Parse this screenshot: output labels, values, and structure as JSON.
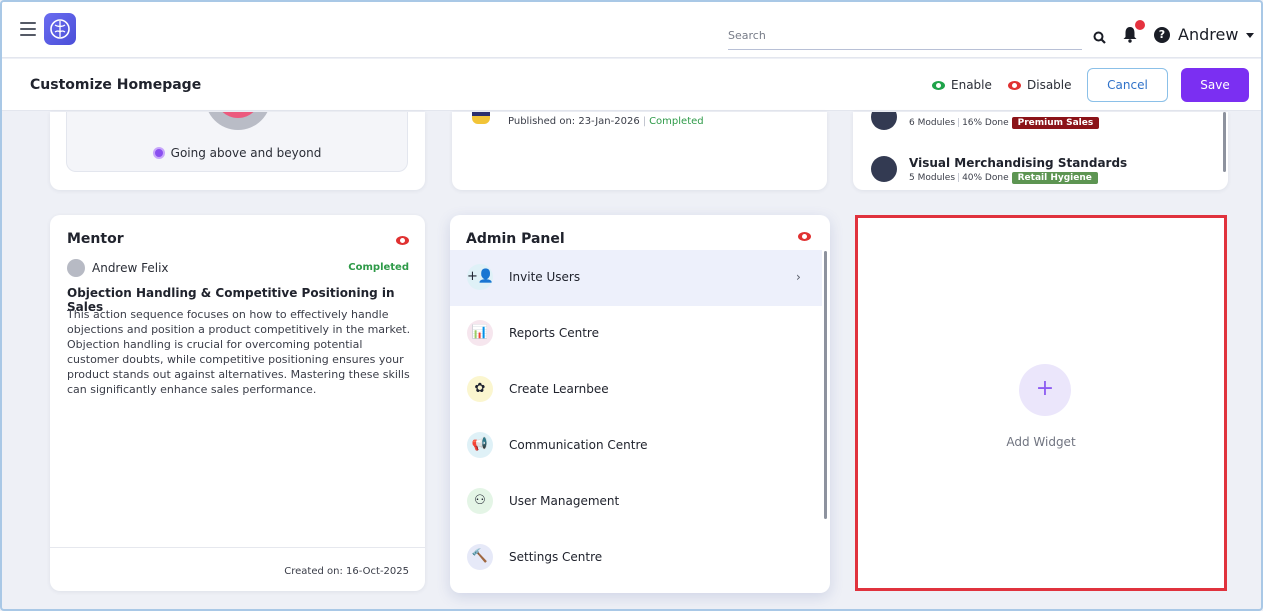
{
  "topbar": {
    "search_placeholder": "Search",
    "user_name": "Andrew",
    "help_glyph": "?"
  },
  "subbar": {
    "title": "Customize Homepage",
    "enable_label": "Enable",
    "disable_label": "Disable",
    "cancel_label": "Cancel",
    "save_label": "Save"
  },
  "badge_card": {
    "label": "Going above and beyond"
  },
  "published_card": {
    "published": "Published on: 23-Jan-2026",
    "separator": "|",
    "status": "Completed"
  },
  "courses_card": {
    "courses": [
      {
        "title": "",
        "modules": "6 Modules",
        "done": "16% Done",
        "tag": "Premium Sales"
      },
      {
        "title": "Visual Merchandising Standards",
        "modules": "5 Modules",
        "done": "40% Done",
        "tag": "Retail Hygiene"
      }
    ]
  },
  "mentor": {
    "title": "Mentor",
    "name": "Andrew Felix",
    "status": "Completed",
    "heading": "Objection Handling & Competitive Positioning in Sales",
    "body": "This action sequence focuses on how to effectively handle objections and position a product competitively in the market. Objection handling is crucial for overcoming potential customer doubts, while competitive positioning ensures your product stands out against alternatives. Mastering these skills can significantly enhance sales performance.",
    "created": "Created on: 16-Oct-2025"
  },
  "admin": {
    "title": "Admin Panel",
    "items": [
      {
        "label": "Invite Users",
        "icon": "invite-users-icon",
        "glyph": "+👤",
        "bg": "#dff1f7",
        "active": true
      },
      {
        "label": "Reports Centre",
        "icon": "reports-icon",
        "glyph": "📊",
        "bg": "#f6e6ee"
      },
      {
        "label": "Create Learnbee",
        "icon": "learnbee-icon",
        "glyph": "✿",
        "bg": "#fbf6cf"
      },
      {
        "label": "Communication Centre",
        "icon": "megaphone-icon",
        "glyph": "📢",
        "bg": "#dff1f7"
      },
      {
        "label": "User Management",
        "icon": "org-chart-icon",
        "glyph": "⚇",
        "bg": "#e4f5e6"
      },
      {
        "label": "Settings Centre",
        "icon": "hammer-icon",
        "glyph": "🔨",
        "bg": "#e6e9f8"
      }
    ],
    "chevron": "›"
  },
  "add_widget": {
    "plus": "+",
    "label": "Add Widget"
  },
  "colors": {
    "accent": "#7b2ff2",
    "enable": "#1fa34a",
    "disable": "#e03131",
    "highlight_border": "#e0323d"
  }
}
